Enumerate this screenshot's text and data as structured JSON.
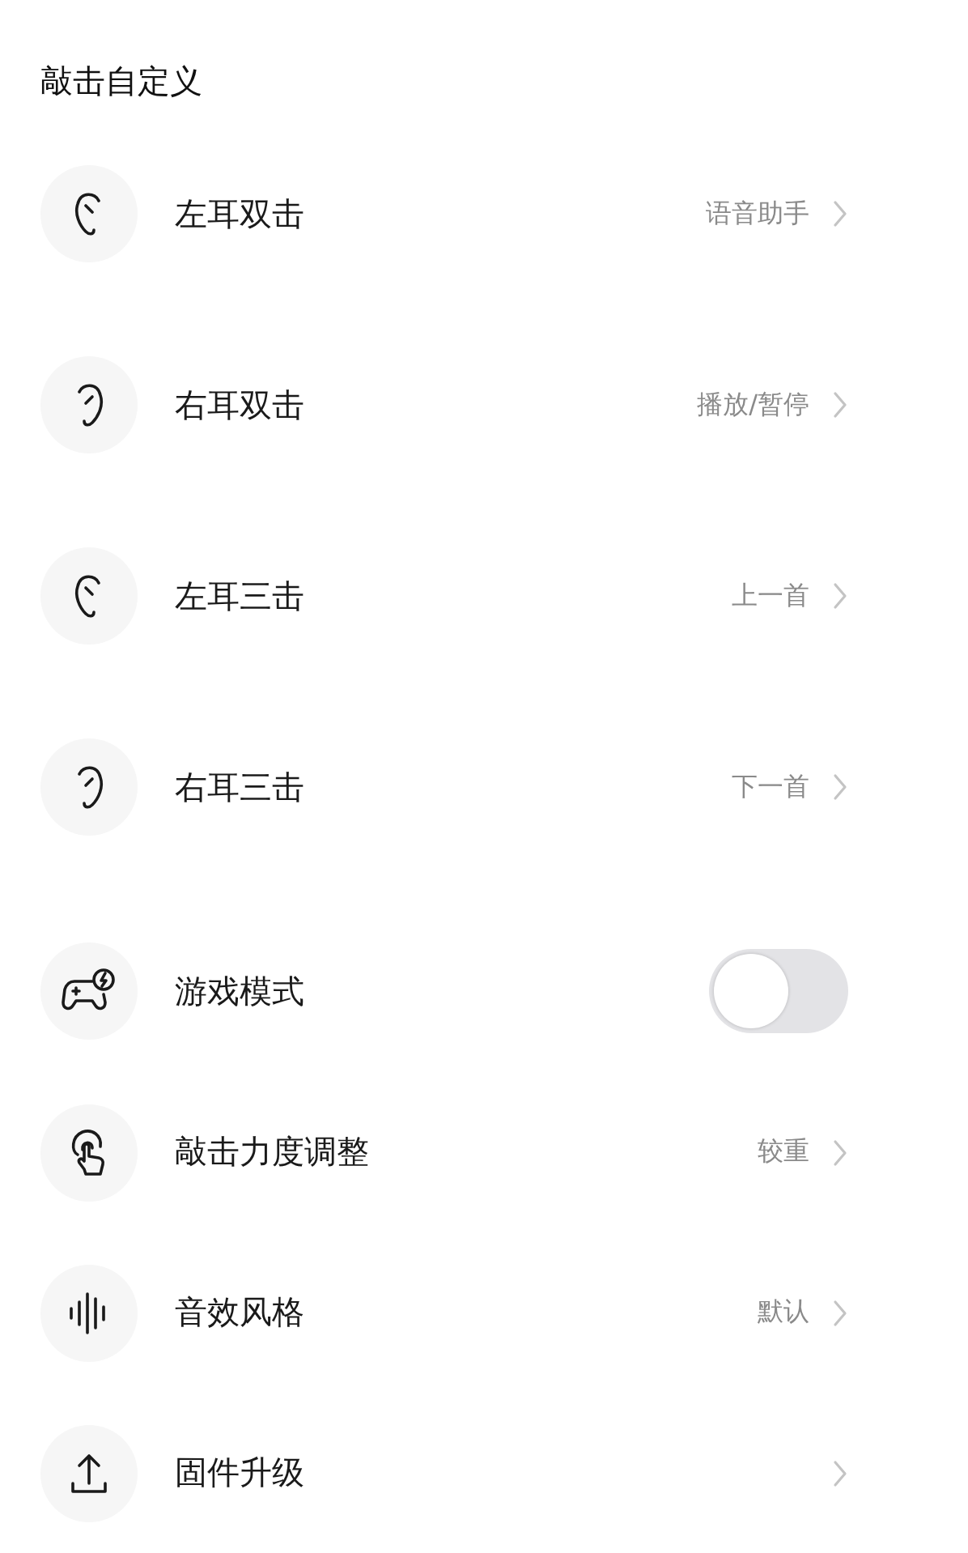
{
  "section_title": "敲击自定义",
  "tap_actions": [
    {
      "label": "左耳双击",
      "value": "语音助手"
    },
    {
      "label": "右耳双击",
      "value": "播放/暂停"
    },
    {
      "label": "左耳三击",
      "value": "上一首"
    },
    {
      "label": "右耳三击",
      "value": "下一首"
    }
  ],
  "settings": [
    {
      "kind": "toggle",
      "label": "游戏模式",
      "on": false
    },
    {
      "kind": "link",
      "label": "敲击力度调整",
      "value": "较重"
    },
    {
      "kind": "link",
      "label": "音效风格",
      "value": "默认"
    },
    {
      "kind": "link",
      "label": "固件升级"
    }
  ]
}
